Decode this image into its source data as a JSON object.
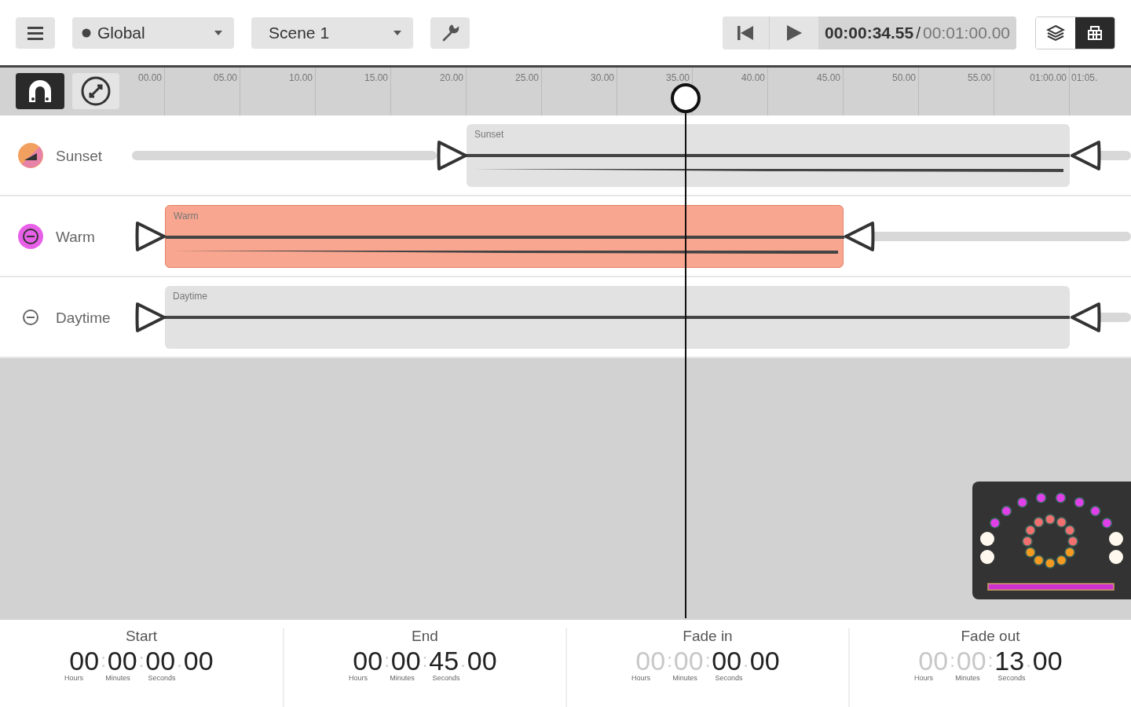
{
  "toolbar": {
    "group_select": {
      "label": "Global"
    },
    "scene_select": {
      "label": "Scene 1"
    },
    "current_time": "00:00:34.55",
    "time_separator": "/",
    "total_time": "00:01:00.00",
    "view_toggles": [
      {
        "selected": false
      },
      {
        "selected": true
      }
    ]
  },
  "ruler": {
    "snap_selected": true,
    "ticks": [
      "00.00",
      "05.00",
      "10.00",
      "15.00",
      "20.00",
      "25.00",
      "30.00",
      "35.00",
      "40.00",
      "45.00",
      "50.00",
      "55.00",
      "01:00.00",
      "01:05."
    ]
  },
  "tracks": [
    {
      "name": "Sunset",
      "color": "#f2a060",
      "kind": "gradient",
      "clip": {
        "label": "Sunset",
        "selected": false,
        "curve": true
      }
    },
    {
      "name": "Warm",
      "color": "#e860e8",
      "kind": "filled",
      "clip": {
        "label": "Warm",
        "selected": true,
        "curve": true
      }
    },
    {
      "name": "Daytime",
      "color": "#666666",
      "kind": "outline",
      "clip": {
        "label": "Daytime",
        "selected": false,
        "curve": false
      }
    }
  ],
  "fields": [
    {
      "label": "Start",
      "groups": [
        {
          "value": "00",
          "dim": false
        },
        {
          "value": "00",
          "dim": false
        },
        {
          "value": "00",
          "dim": false
        },
        {
          "value": "00",
          "dim": false
        }
      ],
      "separators": [
        ":",
        ":",
        "."
      ],
      "units": [
        "Hours",
        "Minutes",
        "Seconds"
      ]
    },
    {
      "label": "End",
      "groups": [
        {
          "value": "00",
          "dim": false
        },
        {
          "value": "00",
          "dim": false
        },
        {
          "value": "45",
          "dim": false
        },
        {
          "value": "00",
          "dim": false
        }
      ],
      "separators": [
        ":",
        ":",
        "."
      ],
      "units": [
        "Hours",
        "Minutes",
        "Seconds"
      ]
    },
    {
      "label": "Fade in",
      "groups": [
        {
          "value": "00",
          "dim": true
        },
        {
          "value": "00",
          "dim": true
        },
        {
          "value": "00",
          "dim": false
        },
        {
          "value": "00",
          "dim": false
        }
      ],
      "separators": [
        ":",
        ":",
        "."
      ],
      "units": [
        "Hours",
        "Minutes",
        "Seconds"
      ]
    },
    {
      "label": "Fade out",
      "groups": [
        {
          "value": "00",
          "dim": true
        },
        {
          "value": "00",
          "dim": true
        },
        {
          "value": "13",
          "dim": false
        },
        {
          "value": "00",
          "dim": false
        }
      ],
      "separators": [
        ":",
        ":",
        "."
      ],
      "units": [
        "Hours",
        "Minutes",
        "Seconds"
      ]
    }
  ]
}
